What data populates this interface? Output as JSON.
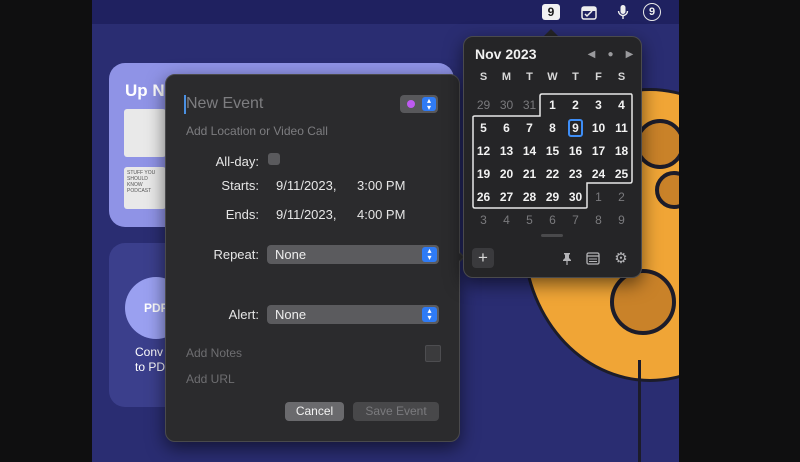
{
  "menubar": {
    "date_badge": "9",
    "badge_count": "9",
    "icons": [
      "calendar-icon",
      "microphone-icon"
    ]
  },
  "background": {
    "card1_title": "Up N",
    "card1_img_text": "STUFF YOU SHOULD KNOW PODCAST",
    "card2_icon_text": "PDF",
    "card2_text_line1": "Conv",
    "card2_text_line2": "to PD"
  },
  "editor": {
    "title_placeholder": "New Event",
    "location_placeholder": "Add Location or Video Call",
    "allday_label": "All-day:",
    "starts_label": "Starts:",
    "starts_date": "9/11/2023,",
    "starts_time": "3:00 PM",
    "ends_label": "Ends:",
    "ends_date": "9/11/2023,",
    "ends_time": "4:00 PM",
    "repeat_label": "Repeat:",
    "repeat_value": "None",
    "alert_label": "Alert:",
    "alert_value": "None",
    "notes_placeholder": "Add Notes",
    "url_placeholder": "Add URL",
    "cancel_label": "Cancel",
    "save_label": "Save Event",
    "calendar_color": "#bf5af2"
  },
  "popover": {
    "month_label": "Nov 2023",
    "nav": [
      "◀",
      "●",
      "▶"
    ],
    "weekdays": [
      "S",
      "M",
      "T",
      "W",
      "T",
      "F",
      "S"
    ],
    "today": "9",
    "weeks": [
      [
        {
          "d": "29",
          "o": true
        },
        {
          "d": "30",
          "o": true
        },
        {
          "d": "31",
          "o": true
        },
        {
          "d": "1"
        },
        {
          "d": "2"
        },
        {
          "d": "3"
        },
        {
          "d": "4"
        }
      ],
      [
        {
          "d": "5"
        },
        {
          "d": "6"
        },
        {
          "d": "7"
        },
        {
          "d": "8"
        },
        {
          "d": "9",
          "t": true
        },
        {
          "d": "10"
        },
        {
          "d": "11"
        }
      ],
      [
        {
          "d": "12"
        },
        {
          "d": "13"
        },
        {
          "d": "14"
        },
        {
          "d": "15"
        },
        {
          "d": "16"
        },
        {
          "d": "17"
        },
        {
          "d": "18"
        }
      ],
      [
        {
          "d": "19"
        },
        {
          "d": "20"
        },
        {
          "d": "21"
        },
        {
          "d": "22"
        },
        {
          "d": "23"
        },
        {
          "d": "24"
        },
        {
          "d": "25"
        }
      ],
      [
        {
          "d": "26"
        },
        {
          "d": "27"
        },
        {
          "d": "28"
        },
        {
          "d": "29"
        },
        {
          "d": "30"
        },
        {
          "d": "1",
          "o": true
        },
        {
          "d": "2",
          "o": true
        }
      ],
      [
        {
          "d": "3",
          "o": true
        },
        {
          "d": "4",
          "o": true
        },
        {
          "d": "5",
          "o": true
        },
        {
          "d": "6",
          "o": true
        },
        {
          "d": "7",
          "o": true
        },
        {
          "d": "8",
          "o": true
        },
        {
          "d": "9",
          "o": true
        }
      ]
    ],
    "accent": "#3e8ef7"
  }
}
